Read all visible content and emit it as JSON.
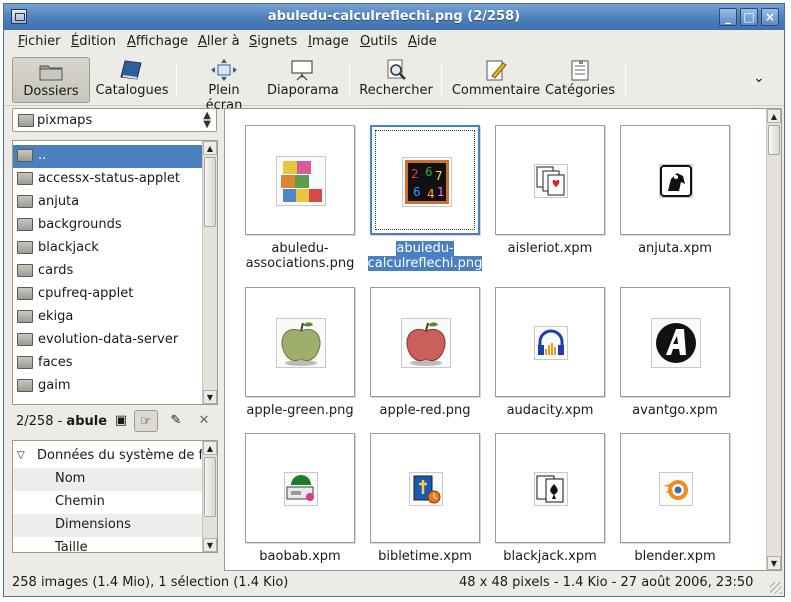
{
  "window": {
    "title": "abuledu-calculreflechi.png  (2/258)",
    "controls": [
      "minimize",
      "maximize",
      "close"
    ]
  },
  "menubar": {
    "items": [
      "Fichier",
      "Édition",
      "Affichage",
      "Aller à",
      "Signets",
      "Image",
      "Outils",
      "Aide"
    ]
  },
  "toolbar": {
    "buttons": [
      {
        "label": "Dossiers",
        "icon": "folder-icon",
        "active": true
      },
      {
        "label": "Catalogues",
        "icon": "book-icon"
      },
      {
        "label": "Plein écran",
        "icon": "fullscreen-icon"
      },
      {
        "label": "Diaporama",
        "icon": "slideshow-icon"
      },
      {
        "label": "Rechercher",
        "icon": "search-icon"
      },
      {
        "label": "Commentaire",
        "icon": "comment-icon"
      },
      {
        "label": "Catégories",
        "icon": "categories-icon"
      }
    ],
    "overflow_icon": "chevron-down-icon"
  },
  "location": {
    "current_folder": "pixmaps"
  },
  "folders": [
    "..",
    "accessx-status-applet",
    "anjuta",
    "backgrounds",
    "blackjack",
    "cards",
    "cpufreq-applet",
    "ekiga",
    "evolution-data-server",
    "faces",
    "gaim"
  ],
  "info_header": {
    "text": "2/258 - ",
    "name": "abule"
  },
  "info_tree": {
    "section": "Données du système de fic",
    "fields": [
      "Nom",
      "Chemin",
      "Dimensions",
      "Taille"
    ]
  },
  "images": [
    {
      "name": "abuledu-\nassociations.png",
      "icon": "letter-blocks-icon"
    },
    {
      "name": "abuledu-\ncalculreflechi.png",
      "icon": "numbers-board-icon",
      "selected": true
    },
    {
      "name": "aisleriot.xpm",
      "icon": "cards-icon"
    },
    {
      "name": "anjuta.xpm",
      "icon": "horse-icon"
    },
    {
      "name": "apple-green.png",
      "icon": "green-apple-icon"
    },
    {
      "name": "apple-red.png",
      "icon": "red-apple-icon"
    },
    {
      "name": "audacity.xpm",
      "icon": "headphones-icon"
    },
    {
      "name": "avantgo.xpm",
      "icon": "avantgo-icon"
    },
    {
      "name": "baobab.xpm",
      "icon": "disk-usage-icon"
    },
    {
      "name": "bibletime.xpm",
      "icon": "bible-icon"
    },
    {
      "name": "blackjack.xpm",
      "icon": "playing-cards-icon"
    },
    {
      "name": "blender.xpm",
      "icon": "blender-icon"
    }
  ],
  "statusbar": {
    "left": "258 images (1.4 Mio), 1 sélection (1.4 Kio)",
    "right": "48 x 48 pixels - 1.4 Kio - 27 août 2006, 23:50"
  },
  "colors": {
    "selection": "#4a7fc0",
    "titlebar": "#4c7fbc"
  }
}
